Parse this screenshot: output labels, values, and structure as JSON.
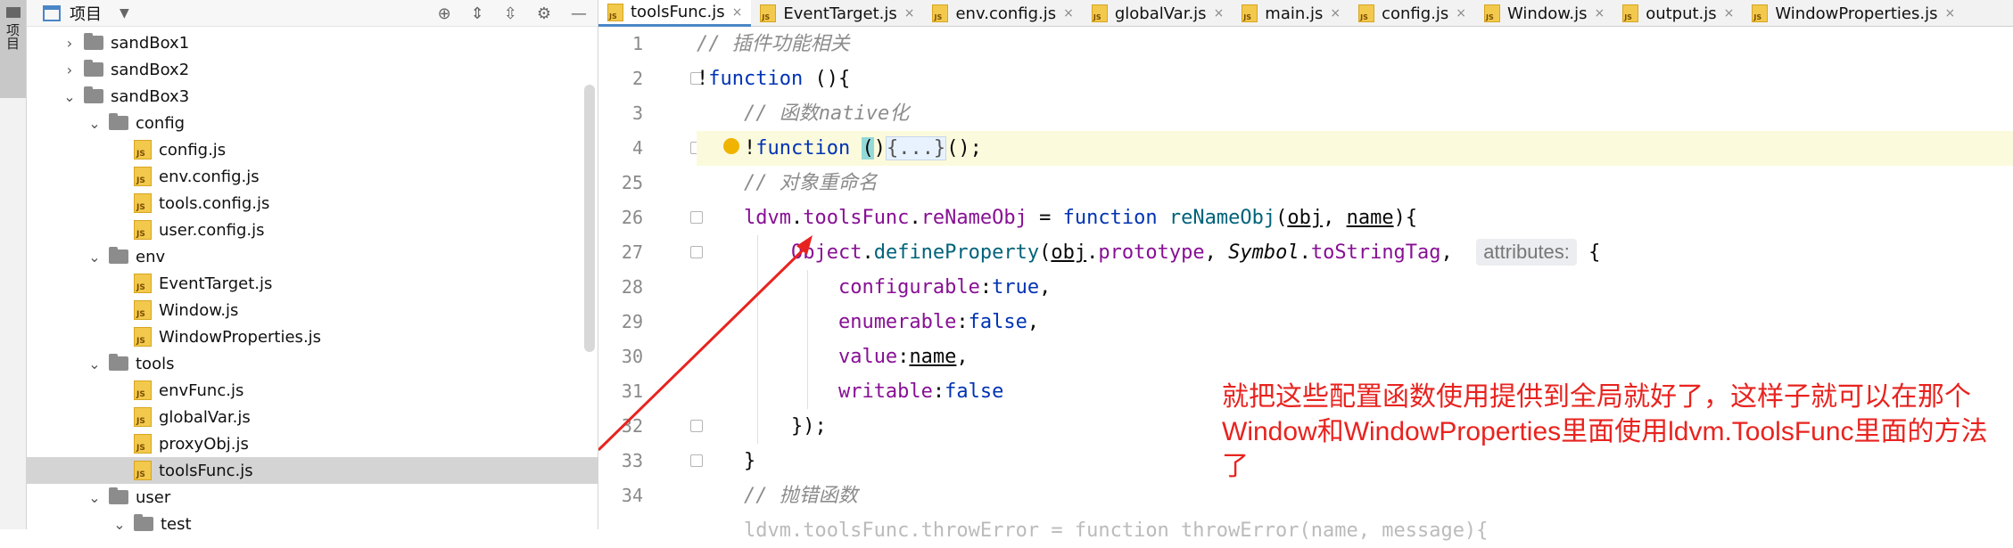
{
  "left_strip": {
    "label": "项目"
  },
  "project": {
    "title": "项目",
    "tree": [
      {
        "label": "sandBox1",
        "kind": "folder",
        "indent": 1,
        "expanded": false
      },
      {
        "label": "sandBox2",
        "kind": "folder",
        "indent": 1,
        "expanded": false
      },
      {
        "label": "sandBox3",
        "kind": "folder",
        "indent": 1,
        "expanded": true
      },
      {
        "label": "config",
        "kind": "folder",
        "indent": 2,
        "expanded": true
      },
      {
        "label": "config.js",
        "kind": "js",
        "indent": 3
      },
      {
        "label": "env.config.js",
        "kind": "js",
        "indent": 3
      },
      {
        "label": "tools.config.js",
        "kind": "js",
        "indent": 3
      },
      {
        "label": "user.config.js",
        "kind": "js",
        "indent": 3
      },
      {
        "label": "env",
        "kind": "folder",
        "indent": 2,
        "expanded": true
      },
      {
        "label": "EventTarget.js",
        "kind": "js",
        "indent": 3
      },
      {
        "label": "Window.js",
        "kind": "js",
        "indent": 3
      },
      {
        "label": "WindowProperties.js",
        "kind": "js",
        "indent": 3
      },
      {
        "label": "tools",
        "kind": "folder",
        "indent": 2,
        "expanded": true
      },
      {
        "label": "envFunc.js",
        "kind": "js",
        "indent": 3
      },
      {
        "label": "globalVar.js",
        "kind": "js",
        "indent": 3
      },
      {
        "label": "proxyObj.js",
        "kind": "js",
        "indent": 3
      },
      {
        "label": "toolsFunc.js",
        "kind": "js",
        "indent": 3,
        "selected": true
      },
      {
        "label": "user",
        "kind": "folder",
        "indent": 2,
        "expanded": true
      },
      {
        "label": "test",
        "kind": "folder",
        "indent": 3,
        "expanded": true
      }
    ]
  },
  "tabs": [
    "toolsFunc.js",
    "EventTarget.js",
    "env.config.js",
    "globalVar.js",
    "main.js",
    "config.js",
    "Window.js",
    "output.js",
    "WindowProperties.js"
  ],
  "active_tab": 0,
  "editor": {
    "line_numbers": [
      "1",
      "2",
      "3",
      "4",
      "25",
      "26",
      "27",
      "28",
      "29",
      "30",
      "31",
      "32",
      "33",
      "34"
    ],
    "comments": {
      "l1": "// 插件功能相关",
      "l3": "// 函数native化",
      "l25": "// 对象重命名",
      "l34": "// 抛错函数"
    },
    "inlay_hint": "attributes:",
    "collapsed": "{...}"
  },
  "annotation": {
    "text": "就把这些配置函数使用提供到全局就好了，这样子就可以在那个Window和WindowProperties里面使用ldvm.ToolsFunc里面的方法了",
    "color": "#e8231f"
  }
}
